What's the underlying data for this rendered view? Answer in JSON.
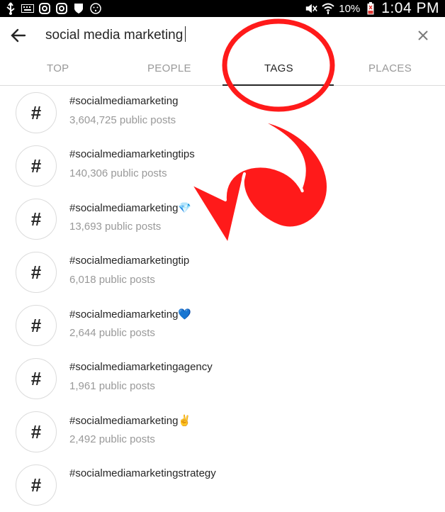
{
  "status_bar": {
    "battery_percent": "10%",
    "time": "1:04 PM"
  },
  "search": {
    "query": "social media marketing"
  },
  "tabs": [
    {
      "label": "TOP",
      "active": false
    },
    {
      "label": "PEOPLE",
      "active": false
    },
    {
      "label": "TAGS",
      "active": true
    },
    {
      "label": "PLACES",
      "active": false
    }
  ],
  "results": [
    {
      "tag": "#socialmediamarketing",
      "posts": "3,604,725 public posts"
    },
    {
      "tag": "#socialmediamarketingtips",
      "posts": "140,306 public posts"
    },
    {
      "tag": "#socialmediamarketing💎",
      "posts": "13,693 public posts"
    },
    {
      "tag": "#socialmediamarketingtip",
      "posts": "6,018 public posts"
    },
    {
      "tag": "#socialmediamarketing💙",
      "posts": "2,644 public posts"
    },
    {
      "tag": "#socialmediamarketingagency",
      "posts": "1,961 public posts"
    },
    {
      "tag": "#socialmediamarketing✌️",
      "posts": "2,492 public posts"
    },
    {
      "tag": "#socialmediamarketingstrategy",
      "posts": ""
    }
  ],
  "hash_symbol": "#",
  "colors": {
    "annotation": "#ff1a1a",
    "text_primary": "#262626",
    "text_secondary": "#999999"
  }
}
